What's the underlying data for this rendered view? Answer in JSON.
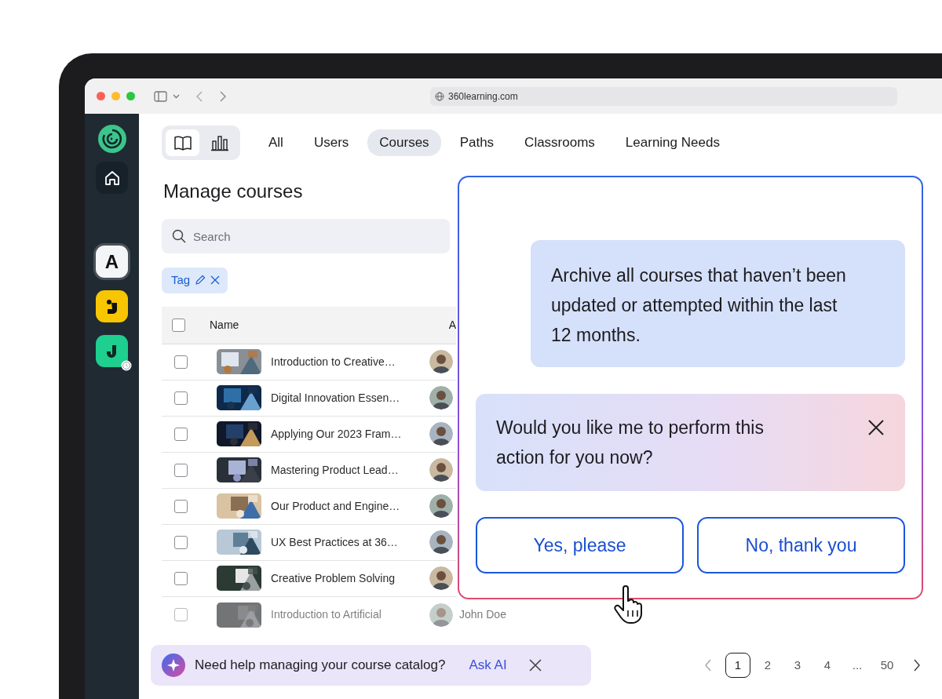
{
  "browser": {
    "url": "360learning.com"
  },
  "view_toggle": [
    {
      "selected": true
    },
    {
      "selected": false
    }
  ],
  "tabs": [
    {
      "label": "All",
      "selected": false
    },
    {
      "label": "Users",
      "selected": false
    },
    {
      "label": "Courses",
      "selected": true
    },
    {
      "label": "Paths",
      "selected": false
    },
    {
      "label": "Classrooms",
      "selected": false
    },
    {
      "label": "Learning Needs",
      "selected": false
    }
  ],
  "sidebar": {
    "apps": [
      {
        "kind": "letter",
        "label": "A",
        "color": "#f4f5f7"
      },
      {
        "kind": "icon",
        "color": "#f7c600"
      },
      {
        "kind": "icon",
        "color": "#1ecf8f",
        "badge": true
      }
    ]
  },
  "page": {
    "title": "Manage courses",
    "search": {
      "placeholder": "Search"
    },
    "filters": [
      {
        "label": "Tag"
      }
    ]
  },
  "table": {
    "all_checked": false,
    "columns": [
      "Name",
      "A"
    ],
    "rows": [
      {
        "name": "Introduction to Creative…",
        "checked": false
      },
      {
        "name": "Digital Innovation Essen…",
        "checked": false
      },
      {
        "name": "Applying Our 2023 Fram…",
        "checked": false
      },
      {
        "name": "Mastering Product Lead…",
        "checked": false
      },
      {
        "name": "Our Product and Engine…",
        "checked": false
      },
      {
        "name": "UX Best Practices at 36…",
        "checked": false
      },
      {
        "name": "Creative Problem Solving",
        "checked": false
      },
      {
        "name": "Introduction to Artificial",
        "author": "John Doe",
        "checked": false
      }
    ]
  },
  "assistant": {
    "messages": [
      {
        "kind": "sent",
        "text": "Archive all courses that haven’t been updated or attempted within the last 12 months."
      },
      {
        "kind": "reply",
        "text": "Would you like me to perform this action for you now?"
      }
    ],
    "actions": [
      {
        "label": "Yes, please"
      },
      {
        "label": "No, thank you"
      }
    ]
  },
  "banner": {
    "text": "Need help managing your course catalog?",
    "link": "Ask AI"
  },
  "pagination": {
    "pages": [
      {
        "label": "1",
        "selected": true
      },
      {
        "label": "2",
        "selected": false
      },
      {
        "label": "3",
        "selected": false
      },
      {
        "label": "4",
        "selected": false
      },
      {
        "label": "...",
        "selected": false
      },
      {
        "label": "50",
        "selected": false
      }
    ]
  }
}
